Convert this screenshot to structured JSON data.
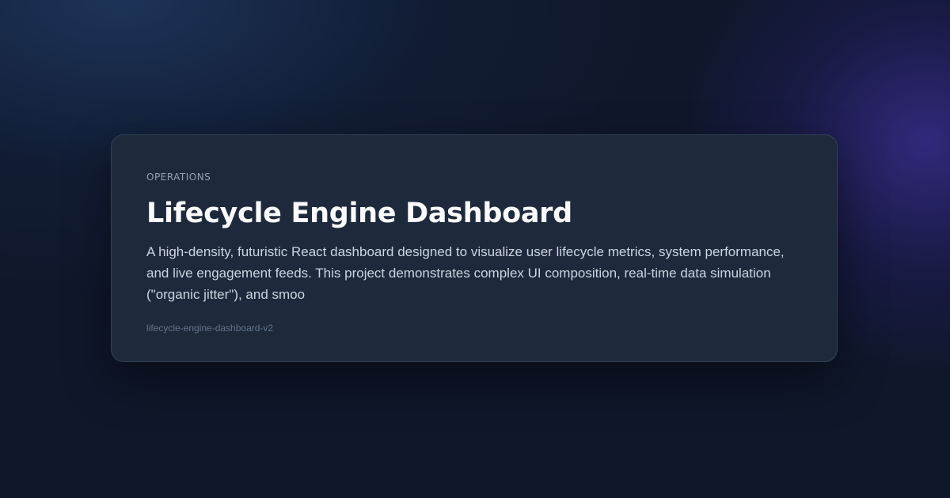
{
  "card": {
    "category": "OPERATIONS",
    "title": "Lifecycle Engine Dashboard",
    "description": "A high-density, futuristic React dashboard designed to visualize user lifecycle metrics, system performance, and live engagement feeds. This project demonstrates complex UI composition, real-time data simulation (\"organic jitter\"), and smoo",
    "slug": "lifecycle-engine-dashboard-v2"
  },
  "colors": {
    "background": "#0f172a",
    "card_background": "#1e293b",
    "card_border": "#334155",
    "glow_purple": "#4c38be",
    "glow_blue": "#284b7d"
  }
}
